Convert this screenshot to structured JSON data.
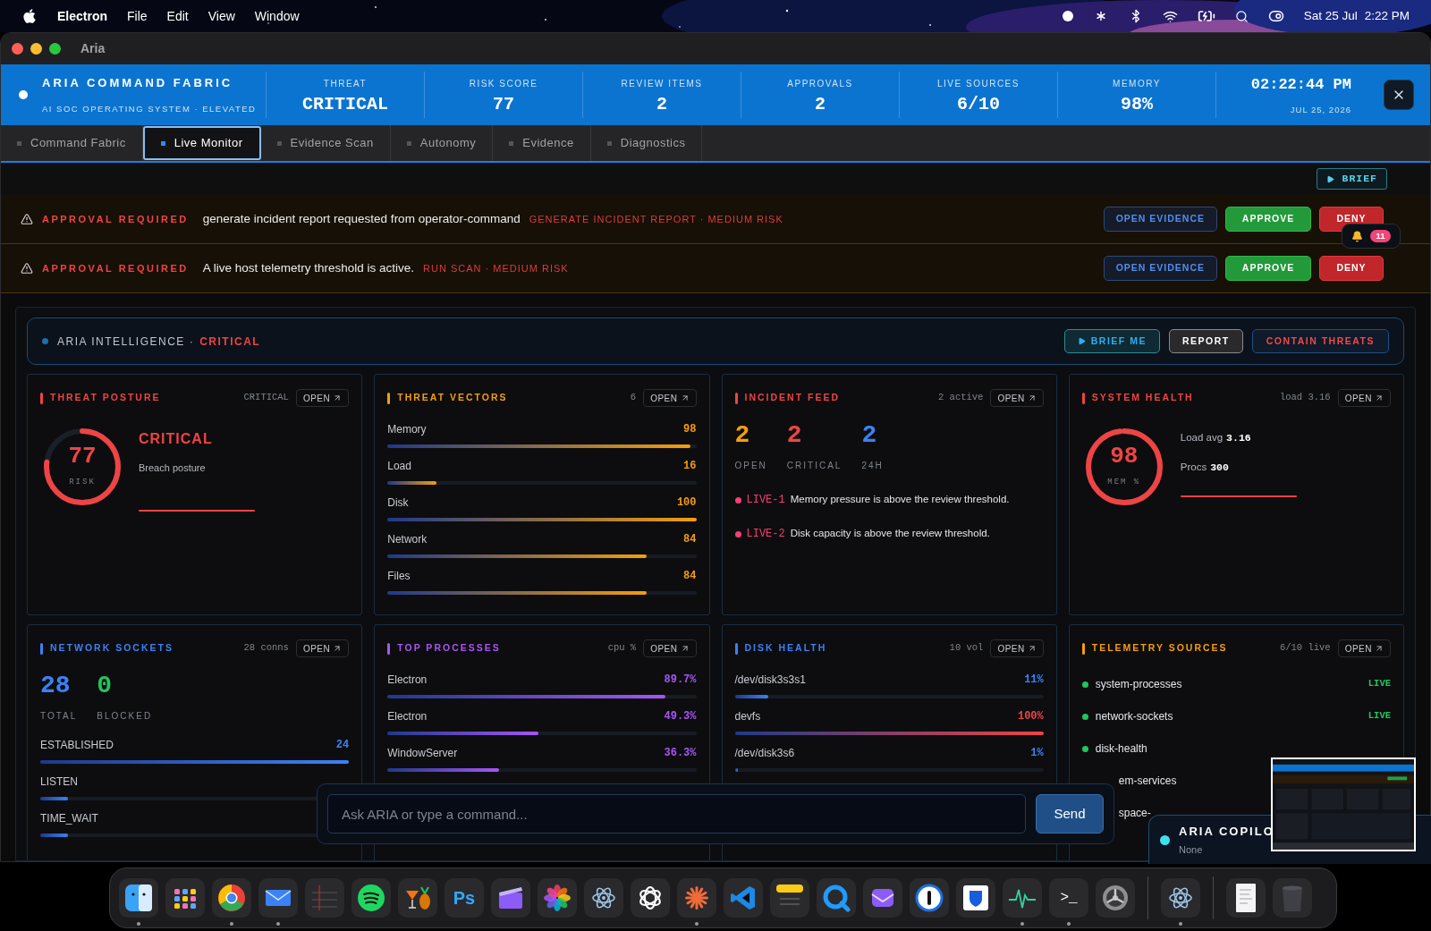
{
  "menubar": {
    "app": "Electron",
    "menus": [
      "File",
      "Edit",
      "View",
      "Window"
    ],
    "date": "Sat 25 Jul",
    "time": "2:22 PM"
  },
  "window": {
    "title": "Aria"
  },
  "header": {
    "brand": "ARIA COMMAND FABRIC",
    "subtitle": "AI SOC OPERATING SYSTEM · ELEVATED",
    "stats": [
      {
        "label": "THREAT",
        "value": "CRITICAL"
      },
      {
        "label": "RISK SCORE",
        "value": "77"
      },
      {
        "label": "REVIEW ITEMS",
        "value": "2"
      },
      {
        "label": "APPROVALS",
        "value": "2"
      },
      {
        "label": "LIVE SOURCES",
        "value": "6/10"
      },
      {
        "label": "MEMORY",
        "value": "98%"
      }
    ],
    "clock": "02:22:44 PM",
    "date": "JUL 25, 2026"
  },
  "tabs": [
    {
      "label": "Command Fabric",
      "selected": false
    },
    {
      "label": "Live Monitor",
      "selected": true
    },
    {
      "label": "Evidence Scan",
      "selected": false
    },
    {
      "label": "Autonomy",
      "selected": false
    },
    {
      "label": "Evidence",
      "selected": false
    },
    {
      "label": "Diagnostics",
      "selected": false
    }
  ],
  "brief_button": "BRIEF",
  "approvals": [
    {
      "tag": "APPROVAL REQUIRED",
      "message": "generate incident report requested from operator-command",
      "action": "GENERATE INCIDENT REPORT · MEDIUM RISK",
      "buttons": [
        "OPEN EVIDENCE",
        "APPROVE",
        "DENY"
      ]
    },
    {
      "tag": "APPROVAL REQUIRED",
      "message": "A live host telemetry threshold is active.",
      "action": "RUN SCAN · MEDIUM RISK",
      "buttons": [
        "OPEN EVIDENCE",
        "APPROVE",
        "DENY"
      ]
    }
  ],
  "notifications": {
    "count": "11"
  },
  "intelligence": {
    "label": "ARIA INTELLIGENCE ·",
    "status": "CRITICAL",
    "buttons": [
      {
        "kind": "brief",
        "label": "BRIEF ME"
      },
      {
        "kind": "report",
        "label": "REPORT"
      },
      {
        "kind": "contain",
        "label": "CONTAIN THREATS"
      }
    ]
  },
  "cards": [
    {
      "kind": "posture",
      "title": "THREAT POSTURE",
      "color": "#ef4444",
      "meta": "CRITICAL",
      "open": "OPEN",
      "ring": {
        "value": "77",
        "label": "RISK",
        "level": 0.77
      },
      "status": "CRITICAL",
      "note": "Breach posture"
    },
    {
      "kind": "bars",
      "title": "THREAT VECTORS",
      "color": "#f59e0b",
      "meta": "6",
      "open": "OPEN",
      "rows": [
        {
          "name": "Memory",
          "value": "98",
          "level": 0.98
        },
        {
          "name": "Load",
          "value": "16",
          "level": 0.16
        },
        {
          "name": "Disk",
          "value": "100",
          "level": 1
        },
        {
          "name": "Network",
          "value": "84",
          "level": 0.84
        },
        {
          "name": "Files",
          "value": "84",
          "level": 0.84
        }
      ]
    },
    {
      "kind": "incidents",
      "title": "INCIDENT FEED",
      "color": "#ef4444",
      "meta": "2 active",
      "open": "OPEN",
      "counters": [
        {
          "value": "2",
          "label": "OPEN",
          "color": "#f59e0b"
        },
        {
          "value": "2",
          "label": "CRITICAL",
          "color": "#ef4444"
        },
        {
          "value": "2",
          "label": "24H",
          "color": "#3b82f6"
        }
      ],
      "items": [
        {
          "id": "LIVE-1",
          "text": "Memory pressure is above the review threshold."
        },
        {
          "id": "LIVE-2",
          "text": "Disk capacity is above the review threshold."
        }
      ]
    },
    {
      "kind": "health",
      "title": "SYSTEM HEALTH",
      "color": "#ef4444",
      "meta": "load 3.16",
      "open": "OPEN",
      "ring": {
        "value": "98",
        "label": "MEM %",
        "level": 0.98
      },
      "stats": [
        {
          "label": "Load avg",
          "value": "3.16"
        },
        {
          "label": "Procs",
          "value": "300"
        }
      ]
    },
    {
      "kind": "sockets",
      "title": "NETWORK SOCKETS",
      "color": "#3b82f6",
      "meta": "28 conns",
      "open": "OPEN",
      "counters": [
        {
          "value": "28",
          "label": "TOTAL",
          "color": "#3b82f6"
        },
        {
          "value": "0",
          "label": "BLOCKED",
          "color": "#22c55e"
        }
      ],
      "rows": [
        {
          "name": "ESTABLISHED",
          "value": "24",
          "level": 1
        },
        {
          "name": "LISTEN",
          "level": 0.09
        },
        {
          "name": "TIME_WAIT",
          "level": 0.09
        }
      ]
    },
    {
      "kind": "bars",
      "title": "TOP PROCESSES",
      "color": "#a855f7",
      "meta": "cpu %",
      "open": "OPEN",
      "rows": [
        {
          "name": "Electron",
          "value": "89.7%",
          "level": 0.9
        },
        {
          "name": "Electron",
          "value": "49.3%",
          "level": 0.49
        },
        {
          "name": "WindowServer",
          "value": "36.3%",
          "level": 0.36
        }
      ]
    },
    {
      "kind": "bars",
      "title": "DISK HEALTH",
      "color": "#3b82f6",
      "meta": "10 vol",
      "open": "OPEN",
      "rows": [
        {
          "name": "/dev/disk3s3s1",
          "value": "11%",
          "level": 0.11,
          "color": "#3b82f6"
        },
        {
          "name": "devfs",
          "value": "100%",
          "level": 1,
          "color": "#ef4444"
        },
        {
          "name": "/dev/disk3s6",
          "value": "1%",
          "level": 0.01,
          "color": "#3b82f6"
        }
      ]
    },
    {
      "kind": "sources",
      "title": "TELEMETRY SOURCES",
      "color": "#f59e0b",
      "meta": "6/10 live",
      "open": "OPEN",
      "items": [
        {
          "kind": "full",
          "name": "system-processes",
          "online": true,
          "status": "LIVE"
        },
        {
          "kind": "full",
          "name": "network-sockets",
          "online": true,
          "status": "LIVE"
        },
        {
          "kind": "full",
          "name": "disk-health",
          "online": true
        },
        {
          "kind": "partial",
          "name": "em-services"
        },
        {
          "kind": "partial",
          "name": "space-"
        }
      ]
    }
  ],
  "command": {
    "placeholder": "Ask ARIA or type a command...",
    "send": "Send"
  },
  "copilot": {
    "title": "ARIA COPILO",
    "status": "None"
  },
  "dock": [
    {
      "kind": "finder",
      "running": true
    },
    {
      "kind": "launchpad",
      "running": false
    },
    {
      "kind": "chrome",
      "running": true
    },
    {
      "kind": "mail",
      "running": true
    },
    {
      "kind": "notebook",
      "running": false
    },
    {
      "kind": "spotify",
      "running": false
    },
    {
      "kind": "drink",
      "running": false
    },
    {
      "kind": "text",
      "text": "Ps",
      "running": false
    },
    {
      "kind": "clapper",
      "running": false
    },
    {
      "kind": "photos",
      "running": false
    },
    {
      "kind": "atom",
      "running": false
    },
    {
      "kind": "knot",
      "running": false
    },
    {
      "kind": "burst",
      "running": true
    },
    {
      "kind": "code",
      "running": false
    },
    {
      "kind": "notes",
      "running": false
    },
    {
      "kind": "quicktime",
      "running": false
    },
    {
      "kind": "mailbox",
      "running": false
    },
    {
      "kind": "keyhole",
      "running": false
    },
    {
      "kind": "shield",
      "running": false
    },
    {
      "kind": "pulse",
      "running": true
    },
    {
      "kind": "text",
      "text": ">_",
      "running": true
    },
    {
      "kind": "gear",
      "running": false
    },
    {
      "kind": "separator"
    },
    {
      "kind": "atom",
      "running": true
    },
    {
      "kind": "separator"
    },
    {
      "kind": "document",
      "running": false
    },
    {
      "kind": "trash",
      "running": false
    }
  ]
}
